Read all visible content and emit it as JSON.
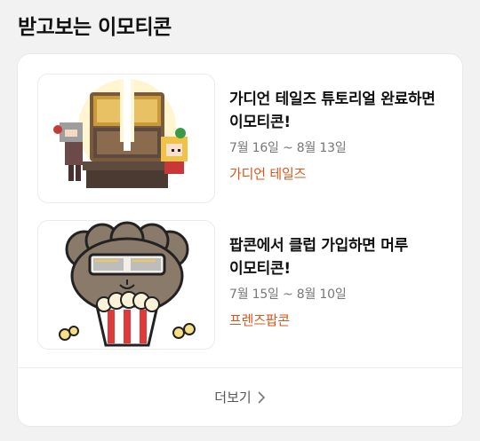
{
  "section": {
    "title": "받고보는 이모티콘"
  },
  "items": [
    {
      "title": "가디언 테일즈 튜토리얼 완료하면 이모티콘!",
      "date": "7월 16일 ~ 8월 13일",
      "brand": "가디언 테일즈",
      "thumbnail": "guardian-tales-treasure-chest-image"
    },
    {
      "title": "팝콘에서 클럽 가입하면 머루 이모티콘!",
      "date": "7월 15일 ~ 8월 10일",
      "brand": "프렌즈팝콘",
      "thumbnail": "meru-popcorn-character-image"
    }
  ],
  "more": {
    "label": "더보기",
    "icon": "chevron-right-icon"
  },
  "colors": {
    "background": "#f2f2f2",
    "card": "#ffffff",
    "brand_accent": "#d4581e",
    "date_text": "#777777"
  }
}
